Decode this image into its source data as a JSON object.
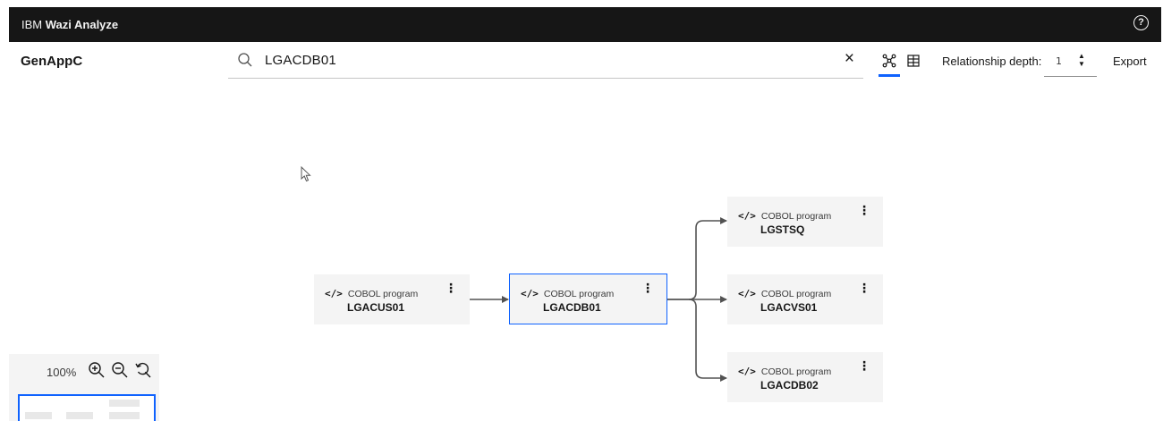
{
  "header": {
    "brand_prefix": "IBM",
    "brand_name": "Wazi Analyze",
    "help_icon": "help-icon"
  },
  "toolbar": {
    "app_name": "GenAppC",
    "search_value": "LGACDB01",
    "clear_label": "×",
    "depth_label": "Relationship depth:",
    "depth_value": "1",
    "export_label": "Export"
  },
  "graph": {
    "node_type": "COBOL program",
    "nodes": [
      {
        "name": "LGACUS01",
        "selected": false
      },
      {
        "name": "LGACDB01",
        "selected": true
      },
      {
        "name": "LGSTSQ",
        "selected": false
      },
      {
        "name": "LGACVS01",
        "selected": false
      },
      {
        "name": "LGACDB02",
        "selected": false
      }
    ],
    "edges": [
      {
        "from": "LGACUS01",
        "to": "LGACDB01"
      },
      {
        "from": "LGACDB01",
        "to": "LGSTSQ"
      },
      {
        "from": "LGACDB01",
        "to": "LGACVS01"
      },
      {
        "from": "LGACDB01",
        "to": "LGACDB02"
      }
    ]
  },
  "zoom": {
    "level": "100%"
  },
  "colors": {
    "accent": "#0f62fe",
    "header_bg": "#161616",
    "node_bg": "#f4f4f4"
  }
}
